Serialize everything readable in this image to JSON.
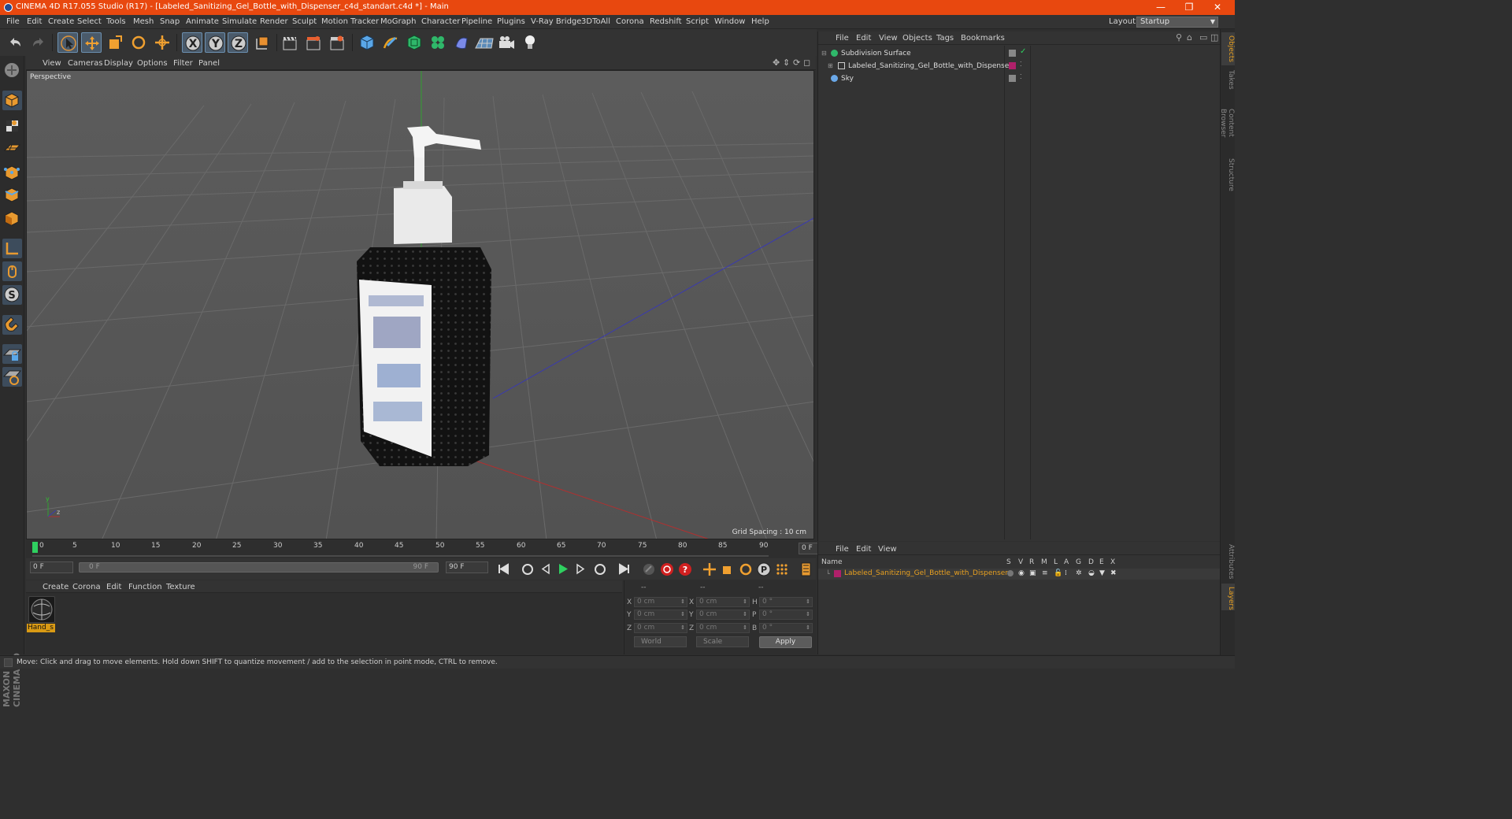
{
  "window": {
    "title": "CINEMA 4D R17.055 Studio (R17) - [Labeled_Sanitizing_Gel_Bottle_with_Dispenser_c4d_standart.c4d *] - Main",
    "minimize": "—",
    "restore": "❐",
    "close": "✕"
  },
  "menu": [
    "File",
    "Edit",
    "Create",
    "Select",
    "Tools",
    "Mesh",
    "Snap",
    "Animate",
    "Simulate",
    "Render",
    "Sculpt",
    "Motion Tracker",
    "MoGraph",
    "Character",
    "Pipeline",
    "Plugins",
    "V-Ray Bridge",
    "3DToAll",
    "Corona",
    "Redshift",
    "Script",
    "Window",
    "Help"
  ],
  "layout": {
    "label": "Layout:",
    "value": "Startup"
  },
  "viewport": {
    "menu": [
      "View",
      "Cameras",
      "Display",
      "Options",
      "Filter",
      "Panel"
    ],
    "label": "Perspective",
    "grid_spacing": "Grid Spacing : 10 cm"
  },
  "timeline": {
    "ticks": [
      "0",
      "5",
      "10",
      "15",
      "20",
      "25",
      "30",
      "35",
      "40",
      "45",
      "50",
      "55",
      "60",
      "65",
      "70",
      "75",
      "80",
      "85",
      "90"
    ],
    "current_frame": "0 F",
    "start_field": "0 F",
    "range_start": "0 F",
    "range_end": "90 F",
    "end_field": "90 F"
  },
  "material_manager": {
    "menu": [
      "Create",
      "Corona",
      "Edit",
      "Function",
      "Texture"
    ],
    "material_name": "Hand_s"
  },
  "coordinates": {
    "headers": [
      "--",
      "--",
      "--"
    ],
    "rows": [
      {
        "a_label": "X",
        "a_val": "0 cm",
        "b_label": "X",
        "b_val": "0 cm",
        "c_label": "H",
        "c_val": "0 °"
      },
      {
        "a_label": "Y",
        "a_val": "0 cm",
        "b_label": "Y",
        "b_val": "0 cm",
        "c_label": "P",
        "c_val": "0 °"
      },
      {
        "a_label": "Z",
        "a_val": "0 cm",
        "b_label": "Z",
        "b_val": "0 cm",
        "c_label": "B",
        "c_val": "0 °"
      }
    ],
    "world": "World",
    "scale": "Scale",
    "apply": "Apply"
  },
  "object_manager": {
    "menu": [
      "File",
      "Edit",
      "View",
      "Objects",
      "Tags",
      "Bookmarks"
    ],
    "objects": [
      {
        "name": "Subdivision Surface"
      },
      {
        "name": "Labeled_Sanitizing_Gel_Bottle_with_Dispenser"
      },
      {
        "name": "Sky"
      }
    ]
  },
  "layer_manager": {
    "menu": [
      "File",
      "Edit",
      "View"
    ],
    "columns": [
      "Name",
      "S",
      "V",
      "R",
      "M",
      "L",
      "A",
      "G",
      "D",
      "E",
      "X"
    ],
    "layer_name": "Labeled_Sanitizing_Gel_Bottle_with_Dispenser"
  },
  "right_tabs": [
    "Objects",
    "Takes",
    "Content Browser",
    "Structure",
    "Attributes",
    "Layers"
  ],
  "status": "Move: Click and drag to move elements. Hold down SHIFT to quantize movement / add to the selection in point mode, CTRL to remove.",
  "colors": {
    "accent": "#e8480f",
    "selection": "#e8a020",
    "layer": "#b0206a"
  }
}
